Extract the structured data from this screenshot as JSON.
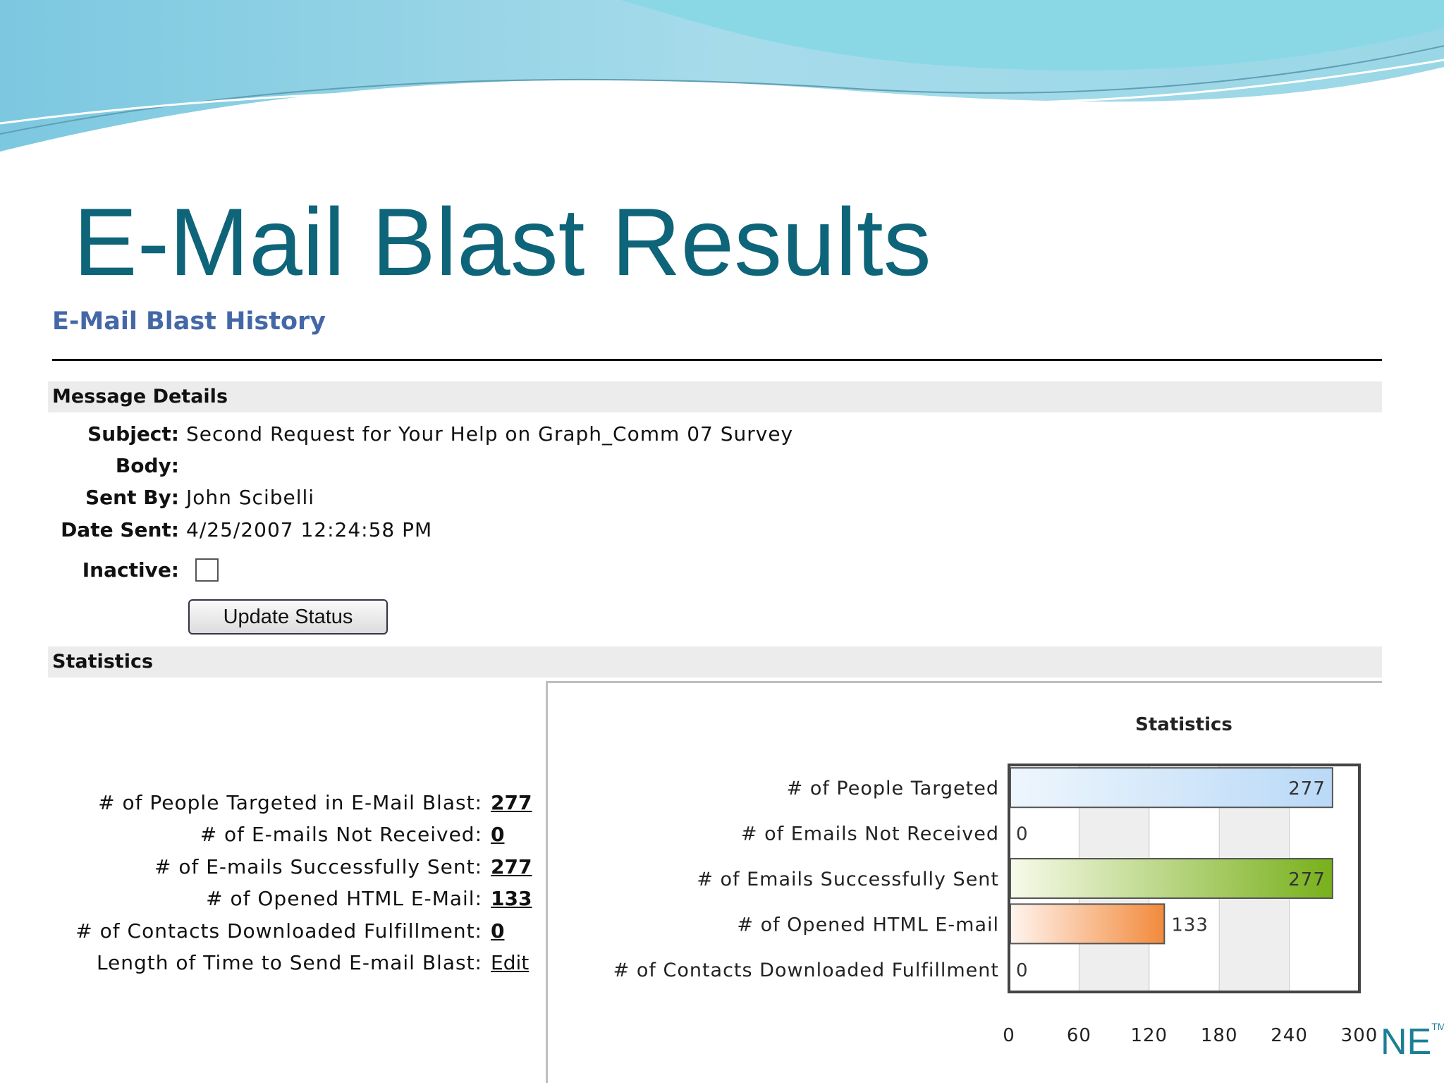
{
  "slide": {
    "title": "E-Mail Blast Results"
  },
  "page": {
    "heading": "E-Mail Blast History"
  },
  "message_details": {
    "header": "Message Details",
    "subject_label": "Subject:",
    "subject": "Second Request for Your Help on Graph_Comm 07 Survey",
    "body_label": "Body:",
    "sent_by_label": "Sent By:",
    "sent_by": "John Scibelli",
    "date_sent_label": "Date Sent:",
    "date_sent": "4/25/2007 12:24:58 PM",
    "inactive_label": "Inactive:",
    "inactive_checked": false,
    "update_button": "Update Status"
  },
  "statistics": {
    "header": "Statistics",
    "rows": [
      {
        "label": "# of People Targeted in E-Mail Blast:",
        "value": "277"
      },
      {
        "label": "# of E-mails Not Received:",
        "value": "0"
      },
      {
        "label": "# of E-mails Successfully Sent:",
        "value": "277"
      },
      {
        "label": "# of Opened HTML E-Mail:",
        "value": "133"
      },
      {
        "label": "# of Contacts Downloaded Fulfillment:",
        "value": "0"
      },
      {
        "label": "Length of Time to Send E-mail Blast:",
        "value": "Edit"
      }
    ]
  },
  "chart_data": {
    "type": "bar",
    "orientation": "horizontal",
    "title": "Statistics",
    "categories": [
      "# of People Targeted",
      "# of Emails Not Received",
      "# of Emails Successfully Sent",
      "# of Opened HTML E-mail",
      "# of Contacts Downloaded Fulfillment"
    ],
    "values": [
      277,
      0,
      277,
      133,
      0
    ],
    "xlim": [
      0,
      300
    ],
    "xticks": [
      0,
      60,
      120,
      180,
      240,
      300
    ],
    "grid": true,
    "colors": [
      [
        "#eef6fd",
        "#b9d9f7"
      ],
      [
        "#ffffff",
        "#ffffff"
      ],
      [
        "#f7faea",
        "#78b01a"
      ],
      [
        "#fff4ee",
        "#f28a3c"
      ],
      [
        "#ffffff",
        "#ffffff"
      ]
    ]
  },
  "branding": {
    "logo_fragment": "ΝE",
    "trademark": "TM"
  }
}
